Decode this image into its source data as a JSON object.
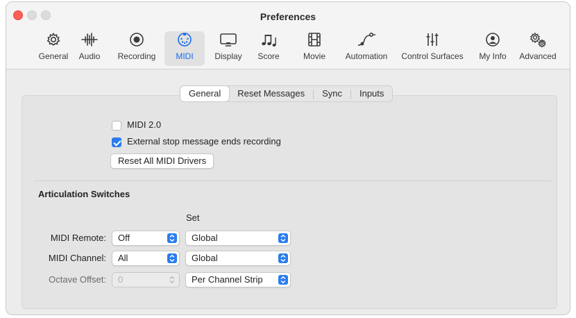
{
  "window": {
    "title": "Preferences"
  },
  "toolbar": {
    "items": [
      {
        "label": "General",
        "icon": "gear-icon"
      },
      {
        "label": "Audio",
        "icon": "waveform-icon"
      },
      {
        "label": "Recording",
        "icon": "record-icon"
      },
      {
        "label": "MIDI",
        "icon": "midi-connector-icon",
        "active": true
      },
      {
        "label": "Display",
        "icon": "display-icon"
      },
      {
        "label": "Score",
        "icon": "music-notes-icon"
      },
      {
        "label": "Movie",
        "icon": "film-icon"
      },
      {
        "label": "Automation",
        "icon": "automation-curve-icon"
      },
      {
        "label": "Control Surfaces",
        "icon": "faders-icon"
      },
      {
        "label": "My Info",
        "icon": "person-icon"
      },
      {
        "label": "Advanced",
        "icon": "gears-icon"
      }
    ],
    "accent_color": "#1a6ee8"
  },
  "tabs": {
    "items": [
      "General",
      "Reset Messages",
      "Sync",
      "Inputs"
    ],
    "selected": "General"
  },
  "general": {
    "midi2_label": "MIDI 2.0",
    "midi2_checked": false,
    "external_stop_label": "External stop message ends recording",
    "external_stop_checked": true,
    "reset_button": "Reset All MIDI Drivers"
  },
  "articulation": {
    "heading": "Articulation Switches",
    "set_header": "Set",
    "rows": [
      {
        "label": "MIDI Remote:",
        "value": "Off",
        "set": "Global",
        "enabled": true
      },
      {
        "label": "MIDI Channel:",
        "value": "All",
        "set": "Global",
        "enabled": true
      },
      {
        "label": "Octave Offset:",
        "value": "0",
        "set": "Per Channel Strip",
        "enabled": false
      }
    ]
  },
  "colors": {
    "checkbox_on": "#2a7cf0",
    "close_button": "#ff5f57"
  }
}
